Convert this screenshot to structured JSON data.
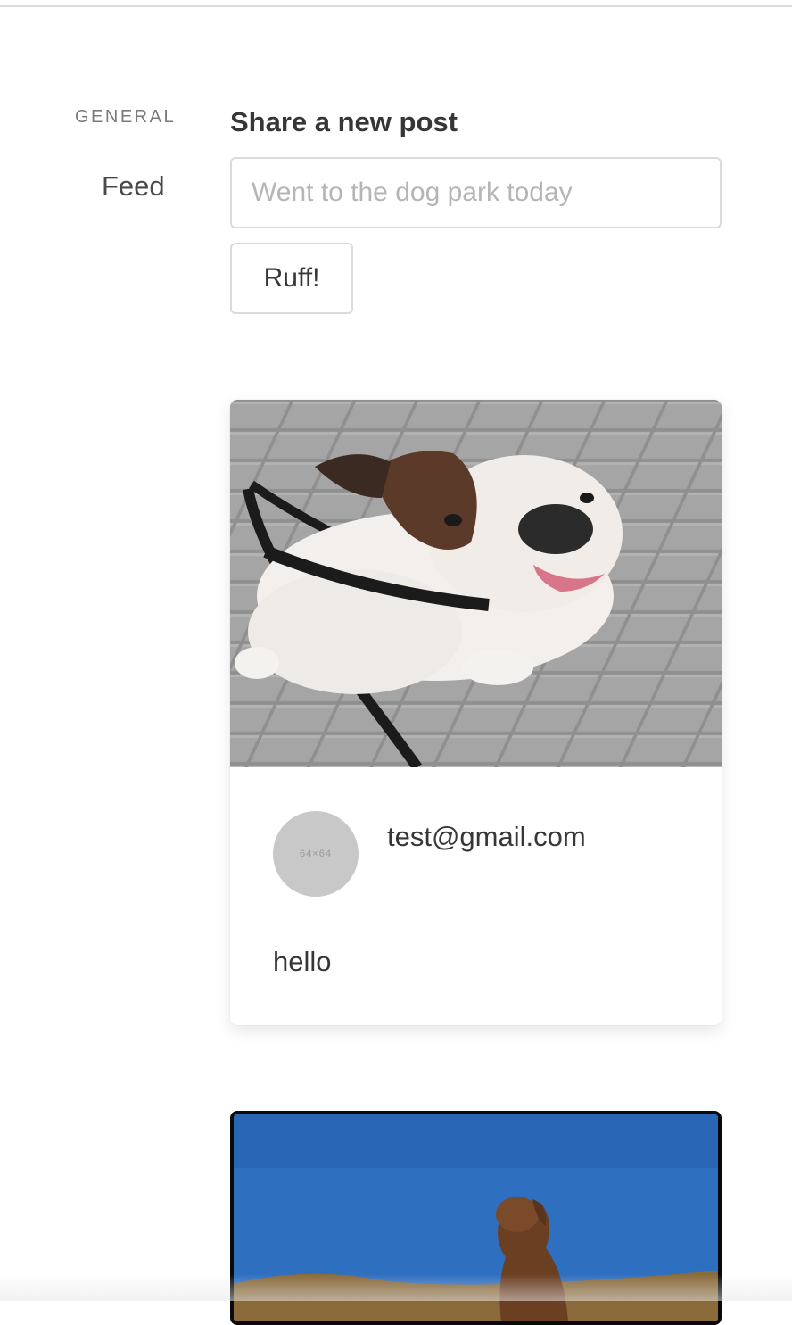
{
  "sidebar": {
    "section_label": "GENERAL",
    "items": [
      {
        "label": "Feed"
      }
    ]
  },
  "composer": {
    "heading": "Share a new post",
    "input_placeholder": "Went to the dog park today",
    "input_value": "",
    "submit_label": "Ruff!"
  },
  "posts": [
    {
      "image": "bulldog-photo",
      "avatar_text": "64×64",
      "author": "test@gmail.com",
      "text": "hello"
    },
    {
      "image": "brown-dog-photo"
    }
  ],
  "colors": {
    "border": "#dbdbdb",
    "text": "#363636",
    "muted": "#7a7a7a",
    "placeholder": "#b5b5b5",
    "avatar": "#c8c8c8",
    "sky": "#2f6fbf"
  }
}
